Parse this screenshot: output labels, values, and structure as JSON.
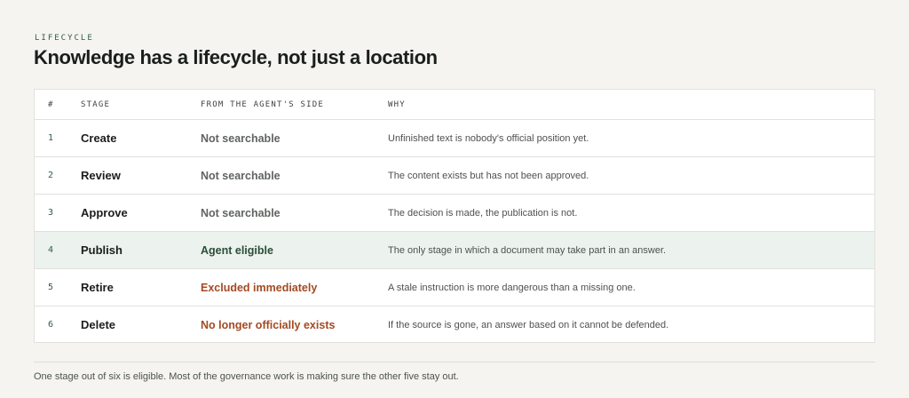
{
  "eyebrow": "LIFECYCLE",
  "title": "Knowledge has a lifecycle, not just a location",
  "table": {
    "headers": {
      "num": "#",
      "stage": "STAGE",
      "side": "FROM THE AGENT'S SIDE",
      "why": "WHY"
    },
    "rows": [
      {
        "num": "1",
        "stage": "Create",
        "side": "Not searchable",
        "side_tone": "neutral",
        "why": "Unfinished text is nobody's official position yet."
      },
      {
        "num": "2",
        "stage": "Review",
        "side": "Not searchable",
        "side_tone": "neutral",
        "why": "The content exists but has not been approved."
      },
      {
        "num": "3",
        "stage": "Approve",
        "side": "Not searchable",
        "side_tone": "neutral",
        "why": "The decision is made, the publication is not."
      },
      {
        "num": "4",
        "stage": "Publish",
        "side": "Agent eligible",
        "side_tone": "good",
        "why": "The only stage in which a document may take part in an answer."
      },
      {
        "num": "5",
        "stage": "Retire",
        "side": "Excluded immediately",
        "side_tone": "bad",
        "why": "A stale instruction is more dangerous than a missing one."
      },
      {
        "num": "6",
        "stage": "Delete",
        "side": "No longer officially exists",
        "side_tone": "bad",
        "why": "If the source is gone, an answer based on it cannot be defended."
      }
    ]
  },
  "footnote": "One stage out of six is eligible. Most of the governance work is making sure the other five stay out.",
  "colors": {
    "accent_green": "#2f5e45",
    "highlight_row": "#ecf2ed",
    "warning_orange": "#a34a22",
    "neutral_gray": "#5f645f"
  }
}
